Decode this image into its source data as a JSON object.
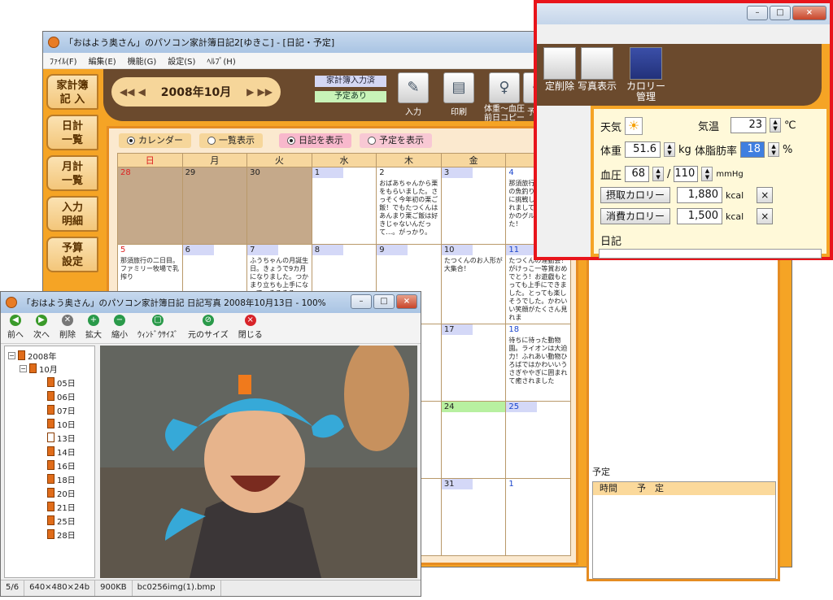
{
  "main": {
    "title": "「おはよう奥さん」のパソコン家計簿日記2[ゆきこ] - [日記・予定]",
    "menu": [
      "ﾌｧｲﾙ(F)",
      "編集(E)",
      "機能(G)",
      "設定(S)",
      "ﾍﾙﾌﾟ(H)"
    ],
    "sidetabs": [
      "家計簿\n記 入",
      "日計\n一覧",
      "月計\n一覧",
      "入力\n明細",
      "予算\n設定"
    ],
    "month_label": "2008年10月",
    "nav_prev": "◀◀ ◀",
    "nav_next": "▶ ▶▶",
    "status_entered": "家計簿入力済",
    "status_planned": "予定あり",
    "tools": [
      "入力",
      "印刷",
      "体重～血圧\n前日コピー",
      "予定"
    ],
    "view_calendar": "カレンダー",
    "view_list": "一覧表示",
    "show_diary": "日記を表示",
    "show_plan": "予定を表示",
    "weekdays": [
      "日",
      "月",
      "火",
      "水",
      "木",
      "金",
      "土"
    ],
    "cells": {
      "r1": [
        "28",
        "29",
        "30",
        "1",
        "2",
        "3",
        "4"
      ],
      "r2": [
        "5",
        "6",
        "7",
        "8",
        "9",
        "10",
        "11"
      ],
      "r3": [
        "17",
        "18"
      ],
      "r4": [
        "24",
        "25"
      ],
      "r5": [
        "31",
        "1"
      ]
    },
    "notes": {
      "d2": "おばあちゃんから栗をもらいました。さっそく今年初の栗ご飯！でもたつくんはあんまり栗ご飯は好きじゃないんだって…。がっかり。",
      "d4": "那須旅行一日目。初の魚釣り！三匹もりに挑戦した。ホテ釣れまして食のバイしかのグルキングもた！",
      "d5": "那須旅行の二日目。ファミリー牧場で乳搾り",
      "d7": "ふうちゃんの月誕生日。きょうで9カ月になりました。つかまり立ちも上手になって、そろそろ",
      "d10": "たつくんのお人形が大集合！",
      "d11": "たつくんの運動会！がけっこ一等賞おめでとう！お遊戯もとっても上手にできました。とっても楽しそうでした。かわいい笑顔がたくさん見れま",
      "d18": "待ちに待った動物園。ライオンは大迫力！ふれあい動物ひろばではかわいいうさぎややぎに囲まれて癒されました"
    },
    "sched_label": "予定",
    "sched_cols": [
      "時間",
      "予　定"
    ]
  },
  "photo": {
    "title": "「おはよう奥さん」のパソコン家計簿日記 日記写真 2008年10月13日 - 100%",
    "tools": [
      "前へ",
      "次へ",
      "削除",
      "拡大",
      "縮小",
      "ｳｨﾝﾄﾞｳｻｲｽﾞ",
      "元のサイズ",
      "閉じる"
    ],
    "tree_year": "2008年",
    "tree_month": "10月",
    "tree_days": [
      "05日",
      "06日",
      "07日",
      "10日",
      "13日",
      "14日",
      "16日",
      "18日",
      "20日",
      "21日",
      "25日",
      "28日"
    ],
    "status": [
      "5/6",
      "640×480×24b",
      "900KB",
      "bc0256img(1).bmp"
    ]
  },
  "zoom": {
    "tools": [
      "定削除",
      "写真表示",
      "カロリー\n管理"
    ],
    "weather_label": "天気",
    "temp_label": "気温",
    "temp_value": "23",
    "temp_unit": "℃",
    "weight_label": "体重",
    "weight_value": "51.6",
    "weight_unit": "kg",
    "fat_label": "体脂肪率",
    "fat_value": "18",
    "fat_unit": "%",
    "bp_label": "血圧",
    "bp_high": "68",
    "bp_sep": "/",
    "bp_low": "110",
    "bp_unit": "mmHg",
    "intake_button": "摂取カロリー",
    "intake_value": "1,880",
    "burn_button": "消費カロリー",
    "burn_value": "1,500",
    "kcal": "kcal",
    "diary_label": "日記",
    "x": "×"
  },
  "colors": {
    "accent_orange": "#f5a425",
    "brown": "#6b4a2d",
    "highlight_red": "#e8141b"
  }
}
